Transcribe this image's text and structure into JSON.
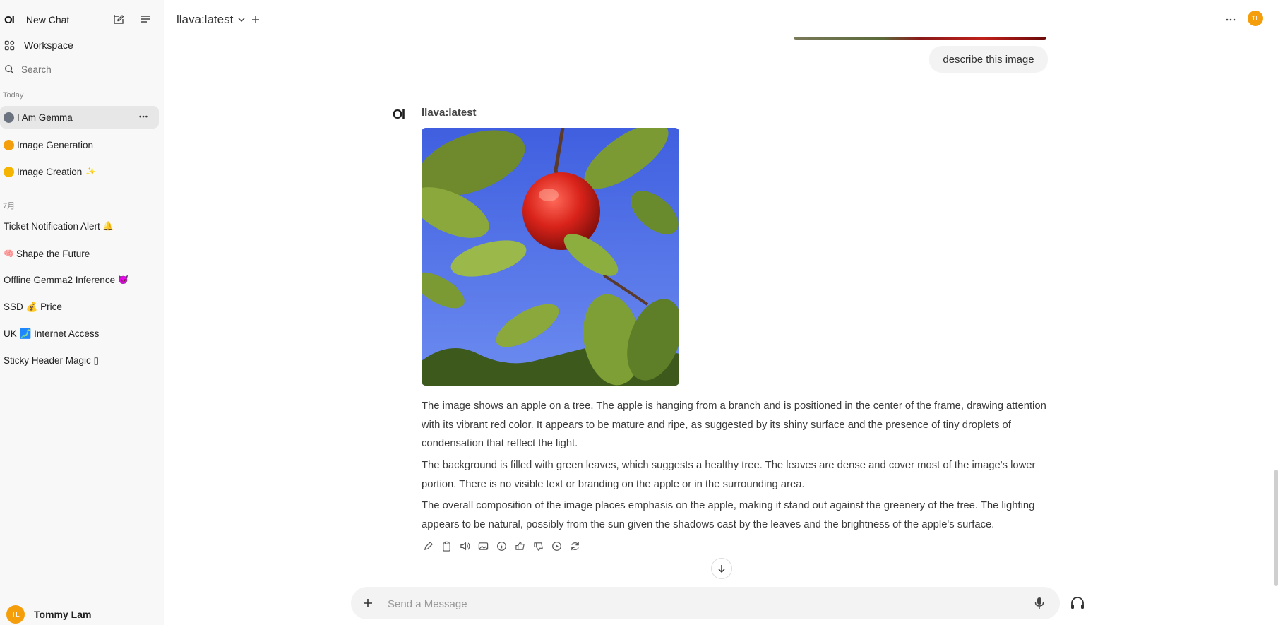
{
  "sidebar": {
    "brand": "OI",
    "new_chat": "New Chat",
    "workspace": "Workspace",
    "search_placeholder": "Search",
    "section_today": "Today",
    "section_july": "7月",
    "chats_today": [
      {
        "label": "I Am Gemma",
        "emoji_color": "#6b7280"
      },
      {
        "label": "Image Generation",
        "emoji_color": "#f59e0b"
      },
      {
        "label": "Image Creation",
        "emoji_color": "#f5b400"
      }
    ],
    "chats_july": [
      {
        "label": "Ticket Notification Alert",
        "suffix": "🔔"
      },
      {
        "label": "Shape the Future",
        "prefix": "🧠"
      },
      {
        "label": "Offline Gemma2 Inference",
        "suffix": "😈"
      },
      {
        "label": "SSD 💰 Price"
      },
      {
        "label": "UK 🗾 Internet Access"
      },
      {
        "label": "Sticky Header Magic ▯"
      }
    ],
    "user": {
      "initials": "TL",
      "name": "Tommy Lam"
    }
  },
  "topbar": {
    "model": "llava:latest",
    "user_initials": "TL"
  },
  "messages": {
    "user_prompt": "describe this image",
    "assistant_logo": "OI",
    "assistant_name": "llava:latest",
    "paragraphs": [
      "The image shows an apple on a tree. The apple is hanging from a branch and is positioned in the center of the frame, drawing attention with its vibrant red color. It appears to be mature and ripe, as suggested by its shiny surface and the presence of tiny droplets of condensation that reflect the light.",
      "The background is filled with green leaves, which suggests a healthy tree. The leaves are dense and cover most of the image's lower portion. There is no visible text or branding on the apple or in the surrounding area.",
      "The overall composition of the image places emphasis on the apple, making it stand out against the greenery of the tree. The lighting appears to be natural, possibly from the sun given the shadows cast by the leaves and the brightness of the apple's surface."
    ]
  },
  "composer": {
    "placeholder": "Send a Message"
  },
  "colors": {
    "accent": "#f59e0b",
    "sidebar_bg": "#f8f8f8",
    "active_item": "#e7e7e7"
  }
}
